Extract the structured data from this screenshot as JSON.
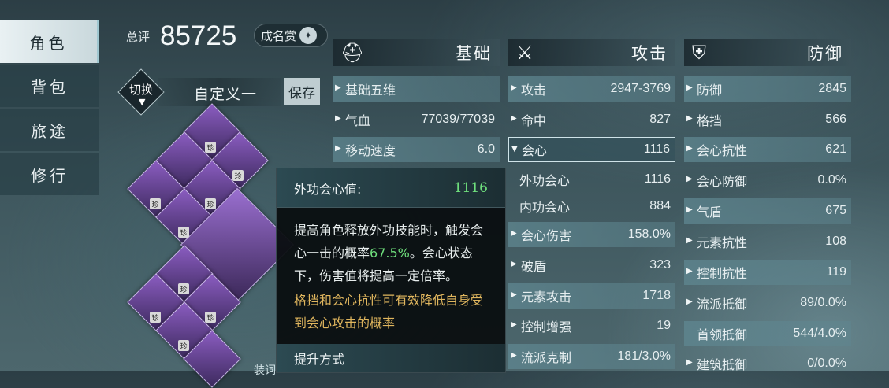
{
  "tabs": [
    {
      "label": "角色",
      "active": true
    },
    {
      "label": "背包",
      "active": false
    },
    {
      "label": "旅途",
      "active": false
    },
    {
      "label": "修行",
      "active": false
    }
  ],
  "score": {
    "label": "总评",
    "value": "85725"
  },
  "fame": {
    "label": "成名赏",
    "icon": "fame-emblem-icon"
  },
  "preset": {
    "switch_label": "切换",
    "name": "自定义一",
    "save_label": "保存"
  },
  "equipment": {
    "badge": "珍"
  },
  "columns": {
    "basic": {
      "title": "基础",
      "icon": "helmet-icon",
      "rows": [
        {
          "label": "基础五维",
          "value": ""
        },
        {
          "label": "气血",
          "value": "77039/77039"
        },
        {
          "label": "移动速度",
          "value": "6.0"
        }
      ]
    },
    "attack": {
      "title": "攻击",
      "icon": "crossed-swords-icon",
      "rows": [
        {
          "label": "攻击",
          "value": "2947-3769"
        },
        {
          "label": "命中",
          "value": "827"
        },
        {
          "label": "会心",
          "value": "1116"
        },
        {
          "label": "外功会心",
          "value": "1116"
        },
        {
          "label": "内功会心",
          "value": "884"
        },
        {
          "label": "会心伤害",
          "value": "158.0%"
        },
        {
          "label": "破盾",
          "value": "323"
        },
        {
          "label": "元素攻击",
          "value": "1718"
        },
        {
          "label": "控制增强",
          "value": "19"
        },
        {
          "label": "流派克制",
          "value": "181/3.0%"
        }
      ]
    },
    "defense": {
      "title": "防御",
      "icon": "shield-icon",
      "rows": [
        {
          "label": "防御",
          "value": "2845"
        },
        {
          "label": "格挡",
          "value": "566"
        },
        {
          "label": "会心抗性",
          "value": "621"
        },
        {
          "label": "会心防御",
          "value": "0.0%"
        },
        {
          "label": "气盾",
          "value": "675"
        },
        {
          "label": "元素抗性",
          "value": "108"
        },
        {
          "label": "控制抗性",
          "value": "119"
        },
        {
          "label": "流派抵御",
          "value": "89/0.0%"
        },
        {
          "label": "首领抵御",
          "value": "544/4.0%"
        },
        {
          "label": "建筑抵御",
          "value": "0/0.0%"
        }
      ]
    }
  },
  "tooltip": {
    "title": "外功会心值:",
    "value": "1116",
    "desc_part1": "提高角色释放外功技能时，触发会心一击的概率",
    "desc_highlight": "67.5%",
    "desc_part2": "。会心状态下，伤害值将提高一定倍率。",
    "note": "格挡和会心抗性可有效降低自身受到会心攻击的概率",
    "footer": "提升方式"
  },
  "partial_text": "装词"
}
